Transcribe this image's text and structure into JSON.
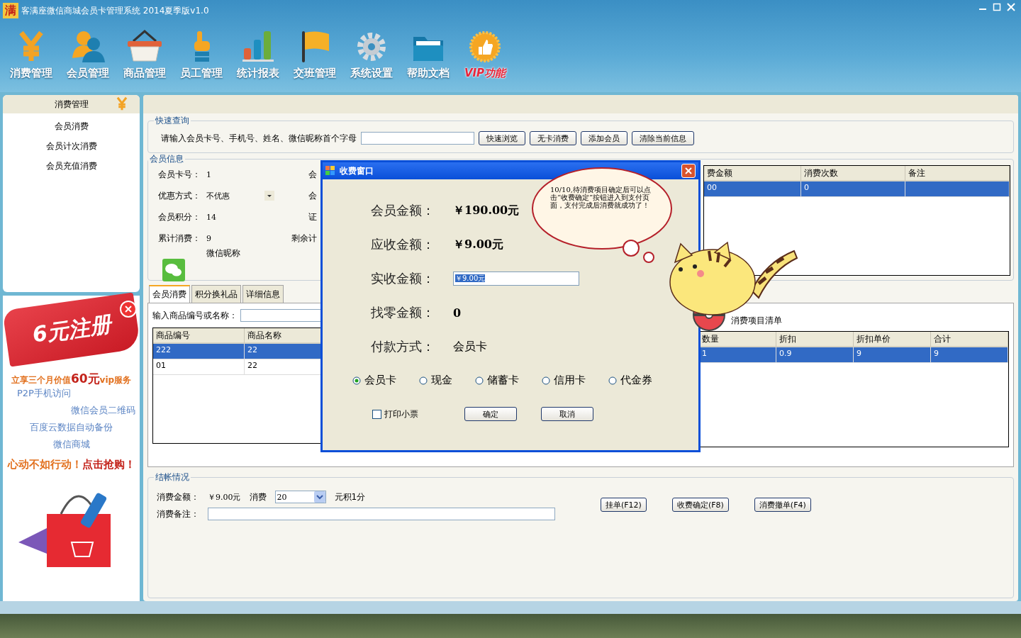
{
  "window": {
    "logo": "满",
    "title": "客满座微信商城会员卡管理系统 2014夏季版v1.0"
  },
  "toolbar": [
    {
      "label": "消费管理",
      "kind": "yen",
      "emphasized": false
    },
    {
      "label": "会员管理",
      "kind": "person",
      "emphasized": false
    },
    {
      "label": "商品管理",
      "kind": "basket",
      "emphasized": false
    },
    {
      "label": "员工管理",
      "kind": "hand",
      "emphasized": false
    },
    {
      "label": "统计报表",
      "kind": "bars",
      "emphasized": false
    },
    {
      "label": "交班管理",
      "kind": "flag",
      "emphasized": false
    },
    {
      "label": "系统设置",
      "kind": "gear",
      "emphasized": false
    },
    {
      "label": "帮助文档",
      "kind": "folder",
      "emphasized": false
    },
    {
      "label": "VIP功能",
      "kind": "badge",
      "emphasized": true
    }
  ],
  "sidebar": {
    "title": "消费管理",
    "items": [
      {
        "label": "会员消费"
      },
      {
        "label": "会员计次消费"
      },
      {
        "label": "会员充值消费"
      }
    ]
  },
  "ad": {
    "headline": "6元注册",
    "offer": "立享三个月价值**60元**vip服务",
    "features": [
      "P2P手机访问",
      "微信会员二维码",
      "百度云数据自动备份",
      "微信商城"
    ],
    "call_to_action": "心动不如行动！**点击抢购！**"
  },
  "quick_query": {
    "legend": "快速查询",
    "label": "请输入会员卡号、手机号、姓名、微信昵称首个字母",
    "buttons": [
      "快速浏览",
      "无卡消费",
      "添加会员",
      "清除当前信息"
    ]
  },
  "member_info": {
    "legend": "会员信息",
    "fields": [
      {
        "label": "会员卡号：",
        "value": "1",
        "kind": "text",
        "right_label": "会"
      },
      {
        "label": "优惠方式：",
        "value": "不优惠",
        "kind": "select",
        "right_label": "会"
      },
      {
        "label": "会员积分：",
        "value": "14",
        "kind": "text",
        "right_label": "证"
      },
      {
        "label": "累计消费：",
        "value": "9",
        "kind": "text",
        "right_label": "剩余计"
      }
    ],
    "wechat_nickname": "微信昵称",
    "grid": {
      "columns": [
        "费金额",
        "消费次数",
        "备注"
      ],
      "rows": [
        {
          "cells": [
            "00",
            "0"
          ],
          "selected": true
        }
      ]
    }
  },
  "tabs": [
    {
      "label": "会员消费",
      "selected": true
    },
    {
      "label": "积分换礼品",
      "selected": false
    },
    {
      "label": "详细信息",
      "selected": false
    }
  ],
  "product_search": {
    "label": "输入商品编号或名称："
  },
  "products": {
    "columns": [
      "商品编号",
      "商品名称"
    ],
    "rows": [
      {
        "cells": [
          "222",
          "22"
        ],
        "selected": true
      },
      {
        "cells": [
          "01",
          "22"
        ],
        "selected": false
      }
    ]
  },
  "cart": {
    "title": "消费项目清单",
    "columns": [
      "数量",
      "折扣",
      "折扣单价",
      "合计"
    ],
    "rows": [
      {
        "cells": [
          "1",
          "0.9",
          "9",
          "9"
        ],
        "selected": true
      }
    ]
  },
  "settlement": {
    "legend": "结帐情况",
    "amount_label": "消费金额：",
    "amount": "￥9.00元",
    "spend_label": "消费",
    "spend_value": "20",
    "points_text": "元积1分",
    "note_label": "消费备注：",
    "buttons": [
      "挂单(F12)",
      "收费确定(F8)",
      "消费撤单(F4)"
    ]
  },
  "dialog": {
    "title": "收费窗口",
    "rows": [
      {
        "label": "会员金额：",
        "value": "￥190.00元",
        "kind": "amount"
      },
      {
        "label": "应收金额：",
        "value": "￥9.00元",
        "kind": "amount"
      },
      {
        "label": "实收金额：",
        "value": "￥9.00元",
        "kind": "input"
      },
      {
        "label": "找零金额：",
        "value": "0",
        "kind": "amount"
      },
      {
        "label": "付款方式：",
        "value": "会员卡",
        "kind": "text"
      }
    ],
    "payment_options": [
      {
        "label": "会员卡",
        "selected": true
      },
      {
        "label": "现金",
        "selected": false
      },
      {
        "label": "储蓄卡",
        "selected": false
      },
      {
        "label": "信用卡",
        "selected": false
      },
      {
        "label": "代金券",
        "selected": false
      }
    ],
    "print_receipt": {
      "label": "打印小票",
      "checked": false
    },
    "buttons": [
      "确定",
      "取消"
    ]
  },
  "tip": {
    "text": "10/10,待消费项目确定后可以点击“收费确定”按钮进入到支付页面，支付完成后消费就成功了！"
  }
}
